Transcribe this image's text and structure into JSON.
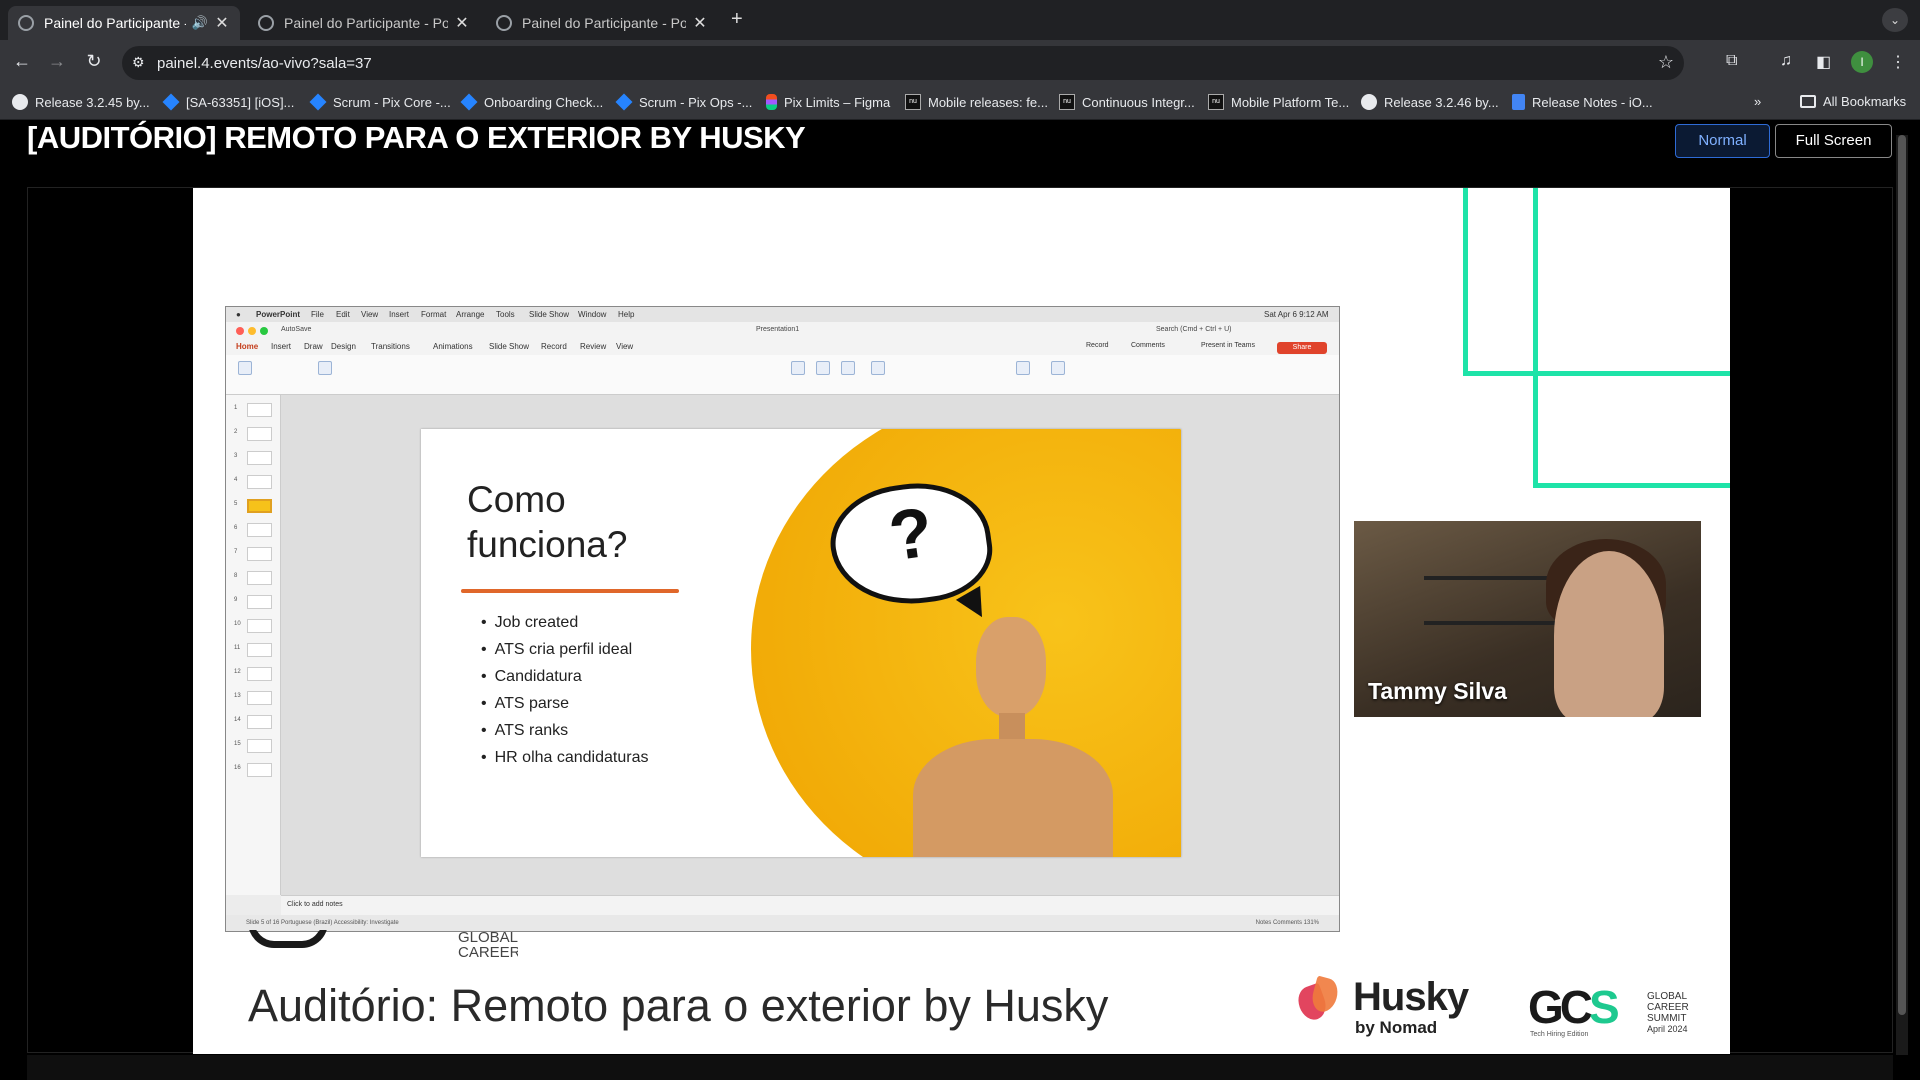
{
  "browser": {
    "tabs": [
      {
        "title": "Painel do Participante - P",
        "active": true,
        "audio": true
      },
      {
        "title": "Painel do Participante - Powe",
        "active": false,
        "audio": false
      },
      {
        "title": "Painel do Participante - Powe",
        "active": false,
        "audio": false
      }
    ],
    "url": "painel.4.events/ao-vivo?sala=37",
    "profile_initial": "I",
    "bookmarks": [
      {
        "label": "Release 3.2.45 by...",
        "icon": "github-icon"
      },
      {
        "label": "[SA-63351] [iOS]...",
        "icon": "jira-icon"
      },
      {
        "label": "Scrum - Pix Core -...",
        "icon": "jira-icon"
      },
      {
        "label": "Onboarding Check...",
        "icon": "jira-icon"
      },
      {
        "label": "Scrum - Pix Ops -...",
        "icon": "jira-icon"
      },
      {
        "label": "Pix Limits – Figma",
        "icon": "figma-icon"
      },
      {
        "label": "Mobile releases: fe...",
        "icon": "nubank-icon"
      },
      {
        "label": "Continuous Integr...",
        "icon": "nubank-icon"
      },
      {
        "label": "Mobile Platform Te...",
        "icon": "nubank-icon"
      },
      {
        "label": "Release 3.2.46 by...",
        "icon": "github-icon"
      },
      {
        "label": "Release Notes - iO...",
        "icon": "docs-icon"
      }
    ],
    "all_bookmarks": "All Bookmarks",
    "overflow": "»"
  },
  "page": {
    "title": "[AUDITÓRIO] REMOTO PARA O EXTERIOR BY HUSKY",
    "normal_button": "Normal",
    "fullscreen_button": "Full Screen"
  },
  "share": {
    "mac_menu": [
      "PowerPoint",
      "File",
      "Edit",
      "View",
      "Insert",
      "Format",
      "Arrange",
      "Tools",
      "Slide Show",
      "Window",
      "Help"
    ],
    "clock": "Sat Apr 6  9:12 AM",
    "doc_title": "Presentation1",
    "search_placeholder": "Search (Cmd + Ctrl + U)",
    "autosave": "AutoSave",
    "ribbon_tabs": [
      "Home",
      "Insert",
      "Draw",
      "Design",
      "Transitions",
      "Animations",
      "Slide Show",
      "Record",
      "Review",
      "View"
    ],
    "record_btn": "Record",
    "comments_btn": "Comments",
    "present_btn": "Present in Teams",
    "share_btn": "Share",
    "slide_numbers": [
      "1",
      "2",
      "3",
      "4",
      "5",
      "6",
      "7",
      "8",
      "9",
      "10",
      "11",
      "12",
      "13",
      "14",
      "15",
      "16"
    ],
    "selected_slide": 5,
    "slide": {
      "title": "Como\nfunciona?",
      "bullets": [
        "Job created",
        "ATS cria perfil ideal",
        "Candidatura",
        "ATS parse",
        "ATS ranks",
        "HR olha candidaturas"
      ],
      "graphic_symbol": "?"
    },
    "notes_placeholder": "Click to add notes",
    "status_left": "Slide 5 of 16    Portuguese (Brazil)    Accessibility: Investigate",
    "status_right": "Notes    Comments    131%"
  },
  "speaker": {
    "name": "Tammy Silva"
  },
  "stage": {
    "footer_title": "Auditório: Remoto para o exterior by Husky",
    "partial_logo_text": "GLOBAL\nCAREER",
    "husky_word": "Husky",
    "husky_sub": "by Nomad",
    "gcs_word": "GCS",
    "gcs_lines": [
      "GLOBAL",
      "CAREER",
      "SUMMIT"
    ],
    "gcs_date": "April 2024",
    "gcs_tag": "Tech Hiring Edition",
    "accent": "#1ee3a8"
  }
}
